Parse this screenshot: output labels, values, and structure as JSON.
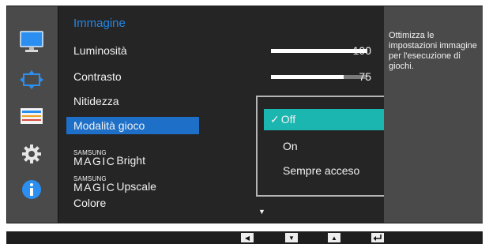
{
  "menu": {
    "title": "Immagine",
    "items": [
      {
        "label": "Luminosità",
        "value": "100",
        "level": 1.0
      },
      {
        "label": "Contrasto",
        "value": "75",
        "level": 0.75
      },
      {
        "label": "Nitidezza"
      },
      {
        "label": "Modalità gioco"
      },
      {
        "brand_top": "SAMSUNG",
        "brand_bottom": "MAGIC",
        "label": "Bright"
      },
      {
        "brand_top": "SAMSUNG",
        "brand_bottom": "MAGIC",
        "label": "Upscale"
      },
      {
        "label": "Colore"
      }
    ]
  },
  "submenu": {
    "options": [
      {
        "label": "Off",
        "selected": true
      },
      {
        "label": "On"
      },
      {
        "label": "Sempre acceso"
      }
    ],
    "check_glyph": "✓"
  },
  "help": {
    "text": "Ottimizza le impostazioni immagine per l'esecuzione di giochi."
  },
  "icons": [
    "picture-icon",
    "resize-icon",
    "onscreen-display-icon",
    "gear-icon",
    "info-icon"
  ],
  "nav": [
    "left-arrow",
    "down-arrow",
    "up-arrow",
    "enter"
  ],
  "colors": {
    "accent_blue": "#1d6fc7",
    "title_blue": "#2486e8",
    "selection_teal": "#1bb6b0"
  }
}
